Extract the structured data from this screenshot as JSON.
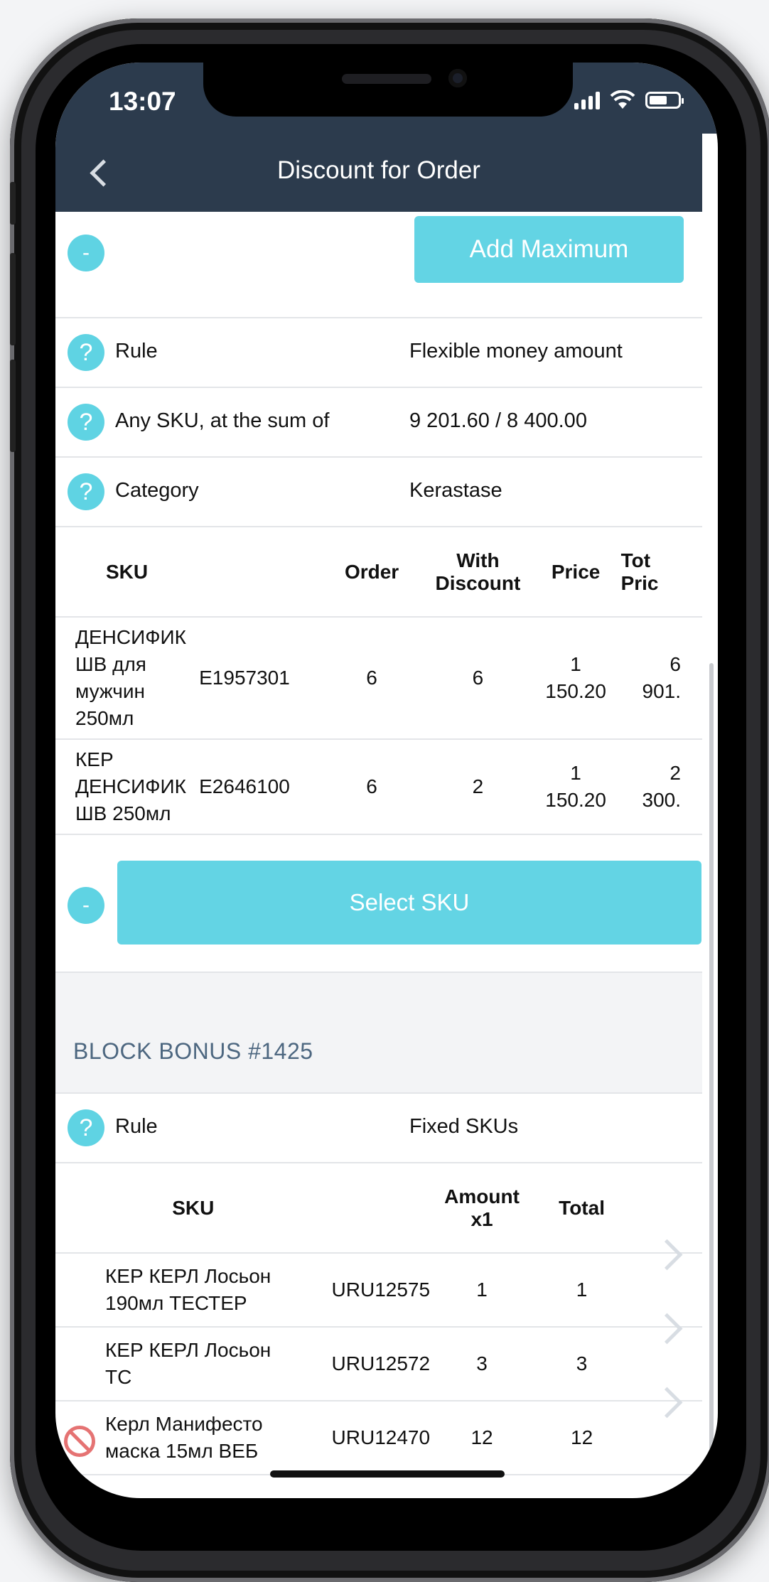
{
  "status": {
    "time": "13:07"
  },
  "nav": {
    "title": "Discount for Order"
  },
  "top": {
    "collapse_glyph": "-",
    "add_max_label": "Add Maximum"
  },
  "info_rows": [
    {
      "label": "Rule",
      "value": "Flexible money amount"
    },
    {
      "label": "Any SKU, at the sum of",
      "value": "9 201.60 / 8 400.00"
    },
    {
      "label": "Category",
      "value": "Kerastase"
    }
  ],
  "sku_table": {
    "headers": {
      "sku": "SKU",
      "order": "Order",
      "with_discount_1": "With",
      "with_discount_2": "Discount",
      "price": "Price",
      "total_1": "Tot",
      "total_2": "Pric"
    },
    "rows": [
      {
        "name": [
          "ДЕНСИФИК",
          "ШВ для",
          "мужчин",
          "250мл"
        ],
        "code": "E1957301",
        "order": "6",
        "with_discount": "6",
        "price": [
          "1",
          "150.20"
        ],
        "total": [
          "6",
          "901."
        ]
      },
      {
        "name": [
          "КЕР",
          "ДЕНСИФИК",
          "ШВ 250мл"
        ],
        "code": "E2646100",
        "order": "6",
        "with_discount": "2",
        "price": [
          "1",
          "150.20"
        ],
        "total": [
          "2",
          "300."
        ]
      }
    ]
  },
  "select_sku": {
    "collapse_glyph": "-",
    "label": "Select SKU"
  },
  "bonus": {
    "title": "BLOCK BONUS #1425",
    "rule_label": "Rule",
    "rule_value": "Fixed SKUs",
    "headers": {
      "sku": "SKU",
      "amount_1": "Amount",
      "amount_2": "x1",
      "total": "Total"
    },
    "rows": [
      {
        "name": [
          "КЕР КЕРЛ Лосьон",
          "190мл ТЕСТЕР"
        ],
        "code": "URU12575",
        "amount": "1",
        "total": "1",
        "blocked": false
      },
      {
        "name": [
          "КЕР КЕРЛ Лосьон",
          "ТС"
        ],
        "code": "URU12572",
        "amount": "3",
        "total": "3",
        "blocked": false
      },
      {
        "name": [
          "Керл Манифесто",
          "маска 15мл ВЕБ"
        ],
        "code": "URU12470",
        "amount": "12",
        "total": "12",
        "blocked": true
      }
    ]
  },
  "colors": {
    "nav": "#2c3b4d",
    "accent": "#63d4e4",
    "section_title": "#4d6780",
    "blocked": "#e57373"
  }
}
